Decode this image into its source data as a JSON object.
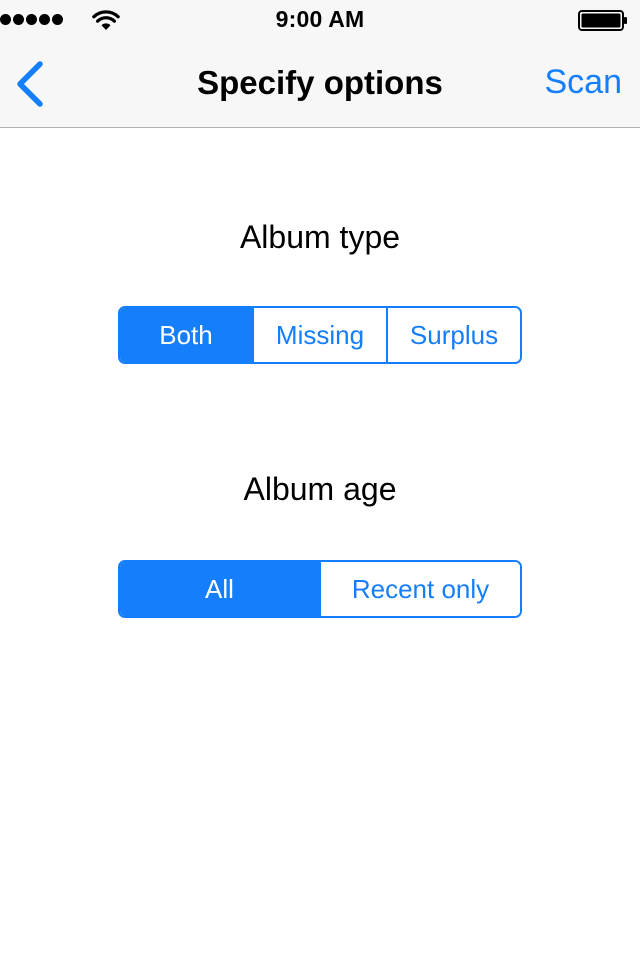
{
  "status_bar": {
    "time": "9:00 AM",
    "signal_bars": 5,
    "icons": [
      "signal-dots-icon",
      "wifi-icon",
      "battery-icon"
    ],
    "battery_level": 1.0
  },
  "nav": {
    "back_icon": "chevron-left-icon",
    "title": "Specify options",
    "scan_label": "Scan"
  },
  "album_type": {
    "label": "Album type",
    "options": [
      "Both",
      "Missing",
      "Surplus"
    ],
    "selected": "Both"
  },
  "album_age": {
    "label": "Album age",
    "options": [
      "All",
      "Recent only"
    ],
    "selected": "All"
  },
  "colors": {
    "accent": "#157efb",
    "bar_background": "#f7f7f7",
    "bar_border": "#b2b2b2",
    "text": "#000000",
    "background": "#ffffff"
  }
}
